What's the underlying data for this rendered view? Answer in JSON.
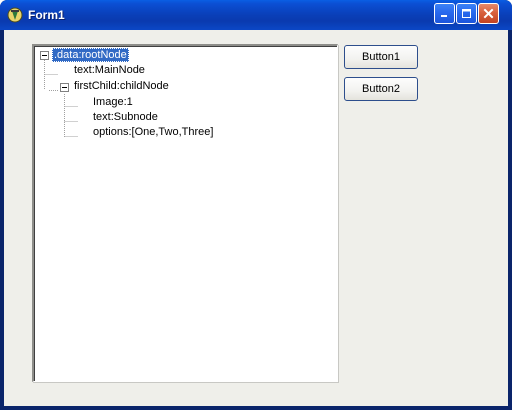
{
  "window": {
    "title": "Form1",
    "controls": [
      "minimize-icon",
      "maximize-icon",
      "close-icon"
    ]
  },
  "tree": {
    "nodes": [
      {
        "label": ".data:rootNode",
        "level": 0,
        "expanded": true,
        "selected": true
      },
      {
        "label": "text:MainNode",
        "level": 1
      },
      {
        "label": "firstChild:childNode",
        "level": 1,
        "expanded": true
      },
      {
        "label": "Image:1",
        "level": 2
      },
      {
        "label": "text:Subnode",
        "level": 2
      },
      {
        "label": "options:[One,Two,Three]",
        "level": 2
      }
    ]
  },
  "buttons": {
    "button1": "Button1",
    "button2": "Button2"
  },
  "colors": {
    "titlebar": "#0a3fb8",
    "selection": "#316ac5",
    "client": "#efefea"
  }
}
